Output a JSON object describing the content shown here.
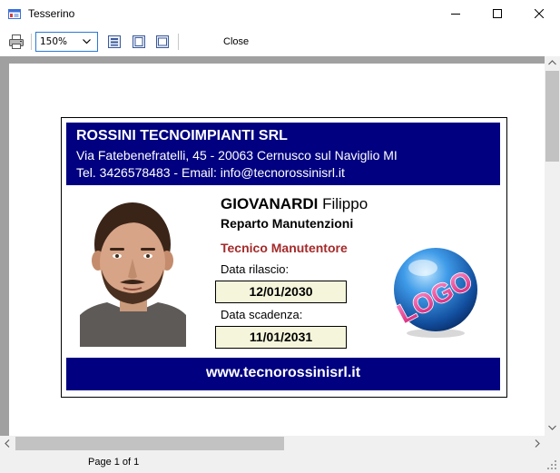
{
  "window": {
    "title": "Tesserino",
    "app_icon": "id-card-icon",
    "controls": [
      "minimize-icon",
      "maximize-icon",
      "close-icon"
    ]
  },
  "toolbar": {
    "print_icon": "printer-icon",
    "zoom_value": "150%",
    "view_icons": [
      "fit-page-icon",
      "single-page-icon",
      "page-width-icon"
    ],
    "close_label": "Close"
  },
  "badge": {
    "company": {
      "name": "ROSSINI TECNOIMPIANTI SRL",
      "address": "Via Fatebenefratelli, 45 - 20063 Cernusco sul Naviglio MI",
      "contact": "Tel. 3426578483 - Email: info@tecnorossinisrl.it"
    },
    "person": {
      "surname": "GIOVANARDI",
      "first_name": "Filippo",
      "department": "Reparto Manutenzioni",
      "role": "Tecnico Manutentore"
    },
    "issue_label": "Data rilascio:",
    "issue_date": "12/01/2030",
    "expiry_label": "Data scadenza:",
    "expiry_date": "11/01/2031",
    "logo_text": "LOGO",
    "website": "www.tecnorossinisrl.it",
    "colors": {
      "header_bg": "#000080",
      "role_text": "#A52A2A",
      "date_box_bg": "#F5F5DC"
    }
  },
  "status": {
    "page": "Page 1 of 1"
  }
}
